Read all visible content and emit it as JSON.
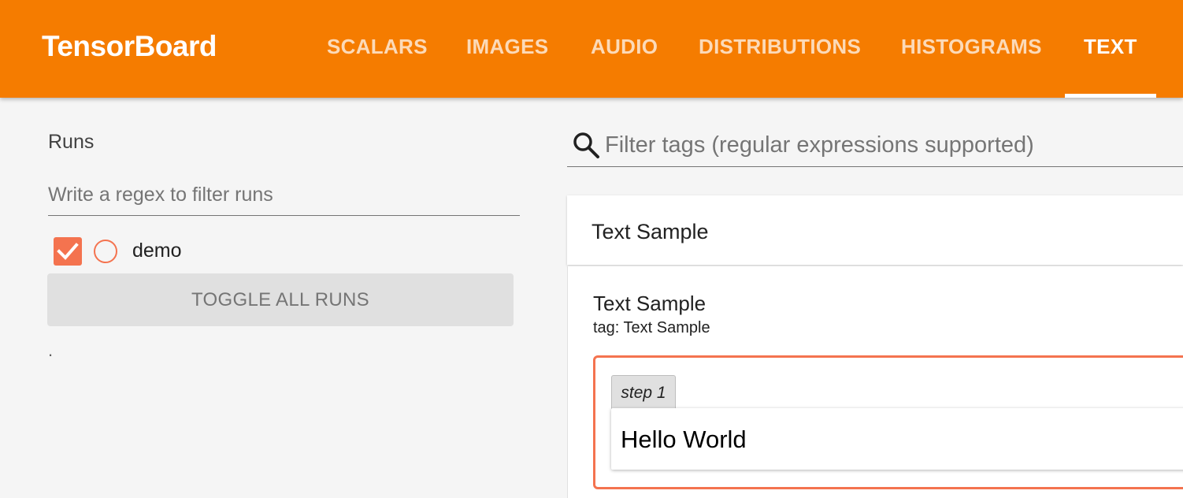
{
  "app": {
    "title": "TensorBoard"
  },
  "nav": {
    "tabs": [
      {
        "label": "SCALARS"
      },
      {
        "label": "IMAGES"
      },
      {
        "label": "AUDIO"
      },
      {
        "label": "DISTRIBUTIONS"
      },
      {
        "label": "HISTOGRAMS"
      },
      {
        "label": "TEXT",
        "active": true
      }
    ]
  },
  "sidebar": {
    "runs_title": "Runs",
    "run_filter_placeholder": "Write a regex to filter runs",
    "runs": [
      {
        "name": "demo",
        "checked": true
      }
    ],
    "toggle_label": "TOGGLE ALL RUNS",
    "footer_text": "."
  },
  "main": {
    "tag_filter_placeholder": "Filter tags (regular expressions supported)",
    "category": {
      "title": "Text Sample",
      "card": {
        "title": "Text Sample",
        "subtitle": "tag: Text Sample",
        "step_label": "step 1",
        "text": "Hello World"
      }
    }
  },
  "colors": {
    "header_bg": "#f57c00",
    "run_accent": "#f4734f",
    "background": "#f5f5f5"
  },
  "icons": {
    "search": "search-icon",
    "checkbox": "check-icon"
  }
}
